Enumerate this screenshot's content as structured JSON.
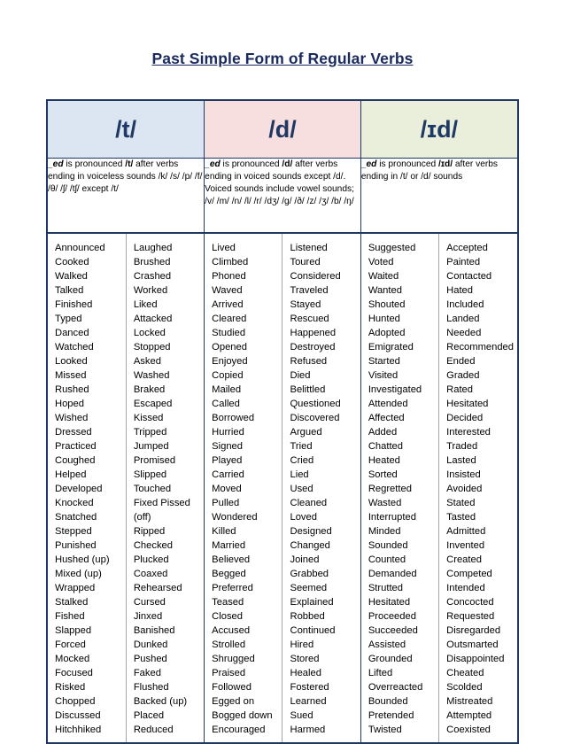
{
  "title": "Past Simple Form of Regular Verbs",
  "colors": {
    "title": "#1b2a5e",
    "border": "#1f3864",
    "header_t_bg": "#dce6f2",
    "header_d_bg": "#f7dfdf",
    "header_id_bg": "#eaefdc",
    "inner_border": "#a6a6a6"
  },
  "groups": [
    {
      "id": "t",
      "header": "/t/",
      "description": {
        "lead": "_ed",
        "rest": " is pronounced ",
        "sound": "/t/",
        "tail": " after verbs ending in voiceless sounds /k/  /s/  /p/  /f/  /θ/  /ʃ/  /tʃ/ except /t/"
      },
      "columns": [
        [
          "Announced",
          "Cooked",
          "Walked",
          "Talked",
          "Finished",
          "Typed",
          "Danced",
          "Watched",
          "Looked",
          "Missed",
          "Rushed",
          "Hoped",
          "Wished",
          "Dressed",
          "Practiced",
          "Coughed",
          "Helped",
          "Developed",
          "Knocked",
          "Snatched",
          "Stepped",
          "Punished",
          "Hushed (up)",
          "Mixed (up)",
          "Wrapped",
          "Stalked",
          "Fished",
          "Slapped",
          "Forced",
          "Mocked",
          "Focused",
          "Risked",
          "Chopped",
          "Discussed",
          "Hitchhiked"
        ],
        [
          "Laughed",
          "Brushed",
          "Crashed",
          "Worked",
          "Liked",
          "Attacked",
          "Locked",
          "Stopped",
          "Asked",
          "Washed",
          "Braked",
          "Escaped",
          "Kissed",
          "Tripped",
          "Jumped",
          "Promised",
          "Slipped",
          "Touched",
          "Fixed Pissed (off)",
          "Ripped",
          "Checked",
          "Plucked",
          "Coaxed",
          "Rehearsed",
          "Cursed",
          "Jinxed",
          "Banished",
          "Dunked",
          "Pushed",
          "Faked",
          "Flushed",
          "Backed (up)",
          "Placed",
          "Reduced"
        ]
      ]
    },
    {
      "id": "d",
      "header": "/d/",
      "description": {
        "lead": "_ed",
        "rest": " is pronounced ",
        "sound": "/d/",
        "tail": " after verbs ending in voiced sounds except /d/. Voiced sounds include vowel sounds; /v/ /m/ /n/ /l/ /r/ /dʒ/ /g/ /ð/ /z/ /ʒ/ /b/ /ŋ/"
      },
      "columns": [
        [
          "Lived",
          "Climbed",
          "Phoned",
          "Waved",
          "Arrived",
          "Cleared",
          "Studied",
          "Opened",
          "Enjoyed",
          "Copied",
          "Mailed",
          "Called",
          "Borrowed",
          "Hurried",
          "Signed",
          "Played",
          "Carried",
          "Moved",
          "Pulled",
          "Wondered",
          "Killed",
          "Married",
          "Believed",
          "Begged",
          "Preferred",
          "Teased",
          "Closed",
          "Accused",
          "Strolled",
          "Shrugged",
          "Praised",
          "Followed",
          "Egged on",
          "Bogged down",
          "Encouraged"
        ],
        [
          "Listened",
          "Toured",
          "Considered",
          "Traveled",
          "Stayed",
          "Rescued",
          "Happened",
          "Destroyed",
          "Refused",
          "Died",
          "Belittled",
          "Questioned",
          "Discovered",
          "Argued",
          "Tried",
          "Cried",
          "Lied",
          "Used",
          "Cleaned",
          "Loved",
          "Designed",
          "Changed",
          "Joined",
          "Grabbed",
          "Seemed",
          "Explained",
          "Robbed",
          "Continued",
          "Hired",
          "Stored",
          "Healed",
          "Fostered",
          "Learned",
          "Sued",
          "Harmed"
        ]
      ]
    },
    {
      "id": "id",
      "header": "/ɪd/",
      "description": {
        "lead": "_ed",
        "rest": " is pronounced ",
        "sound": "/ɪd/",
        "tail": " after verbs ending in /t/ or /d/ sounds"
      },
      "columns": [
        [
          "Suggested",
          "Voted",
          "Waited",
          "Wanted",
          "Shouted",
          "Hunted",
          "Adopted",
          "Emigrated",
          "Started",
          "Visited",
          "Investigated",
          "Attended",
          "Affected",
          "Added",
          "Chatted",
          "Heated",
          "Sorted",
          "Regretted",
          "Wasted",
          "Interrupted",
          "Minded",
          "Sounded",
          "Counted",
          "Demanded",
          "Strutted",
          "Hesitated",
          "Proceeded",
          "Succeeded",
          "Assisted",
          "Grounded",
          "Lifted",
          "Overreacted",
          "Bounded",
          "Pretended",
          "Twisted"
        ],
        [
          "Accepted",
          "Painted",
          "Contacted",
          "Hated",
          "Included",
          "Landed",
          "Needed",
          "Recommended",
          "Ended",
          "Graded",
          "Rated",
          "Hesitated",
          "Decided",
          "Interested",
          "Traded",
          "Lasted",
          "Insisted",
          "Avoided",
          "Stated",
          "Tasted",
          "Admitted",
          "Invented",
          "Created",
          "Competed",
          "Intended",
          "Concocted",
          "Requested",
          "Disregarded",
          "Outsmarted",
          "Disappointed",
          "Cheated",
          "Scolded",
          "Mistreated",
          "Attempted",
          "Coexisted"
        ]
      ]
    }
  ]
}
